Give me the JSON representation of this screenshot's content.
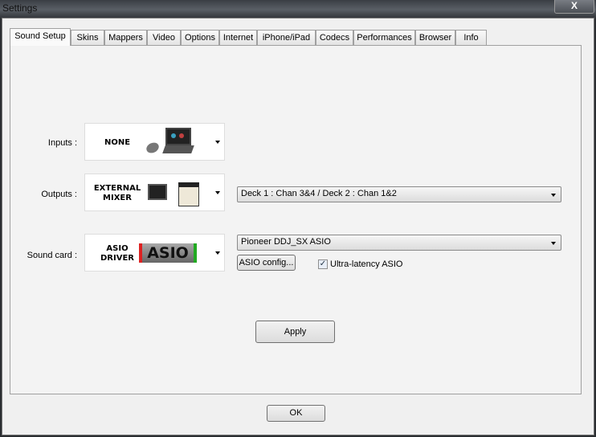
{
  "window": {
    "title": "Settings",
    "close_label": "X"
  },
  "tabs": [
    "Sound Setup",
    "Skins",
    "Mappers",
    "Video",
    "Options",
    "Internet",
    "iPhone/iPad",
    "Codecs",
    "Performances",
    "Browser",
    "Info"
  ],
  "inputs": {
    "label": "Inputs :",
    "value_line1": "NONE"
  },
  "outputs": {
    "label": "Outputs :",
    "value_line1": "EXTERNAL",
    "value_line2": "MIXER",
    "routing": "Deck 1 : Chan 3&4 / Deck 2 : Chan 1&2"
  },
  "soundcard": {
    "label": "Sound card :",
    "value_line1": "ASIO",
    "value_line2": "DRIVER",
    "logo": "ASIO",
    "device": "Pioneer DDJ_SX ASIO",
    "config_label": "ASIO config...",
    "ultra_latency_label": "Ultra-latency ASIO",
    "ultra_latency_checked": true
  },
  "apply_label": "Apply",
  "ok_label": "OK"
}
